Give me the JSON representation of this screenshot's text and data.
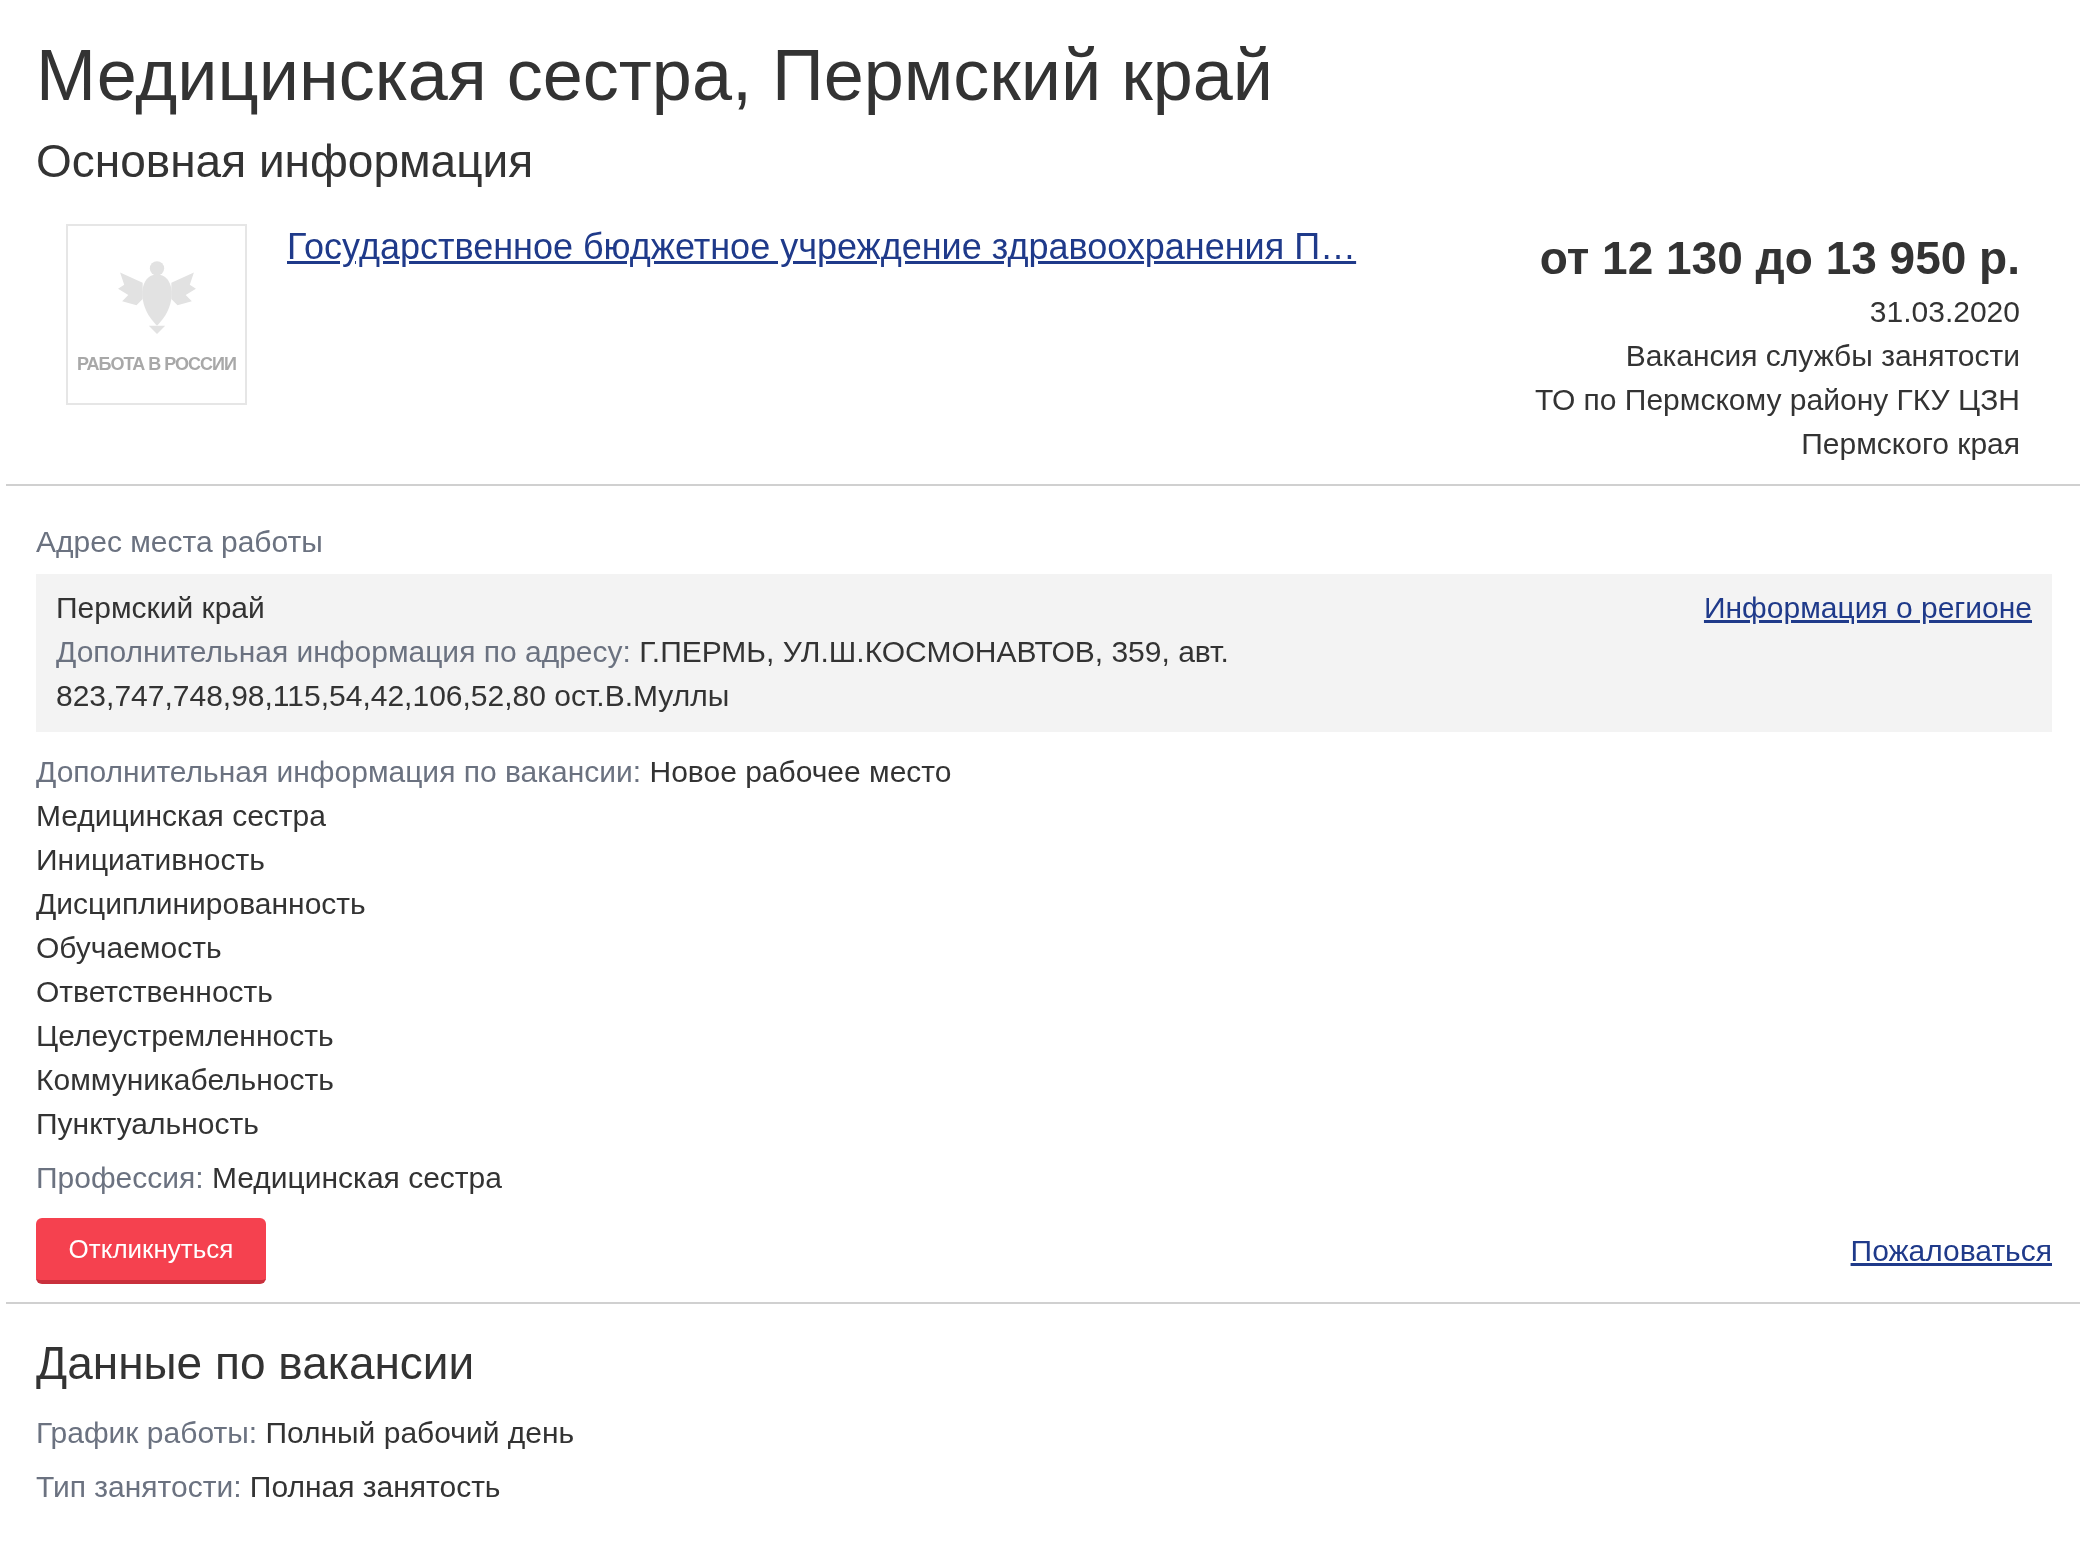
{
  "title": "Медицинская сестра, Пермский край",
  "section_title": "Основная информация",
  "employer": {
    "logo_text": "РАБОТА В РОССИИ",
    "name": "Государственное бюджетное учреждение здравоохранения П…"
  },
  "salary": "от 12 130 до 13 950 р.",
  "date": "31.03.2020",
  "source_lines": [
    "Вакансия службы занятости",
    "ТО по Пермскому району ГКУ ЦЗН",
    "Пермского края"
  ],
  "address": {
    "label": "Адрес места работы",
    "region": "Пермский край",
    "region_link": "Информация о регионе",
    "extra_label": "Дополнительная информация по адресу:",
    "extra_value": "Г.ПЕРМЬ, УЛ.Ш.КОСМОНАВТОВ, 359, авт. 823,747,748,98,115,54,42,106,52,80 ост.В.Муллы"
  },
  "vacancy_info": {
    "label": "Дополнительная информация по вакансии:",
    "value": "Новое рабочее место"
  },
  "requirements": [
    "Медицинская сестра",
    "Инициативность",
    "Дисциплинированность",
    "Обучаемость",
    "Ответственность",
    "Целеустремленность",
    "Коммуникабельность",
    "Пунктуальность"
  ],
  "profession": {
    "label": "Профессия:",
    "value": "Медицинская сестра"
  },
  "respond_button": "Откликнуться",
  "complain_link": "Пожаловаться",
  "details": {
    "title": "Данные по вакансии",
    "rows": [
      {
        "label": "График работы:",
        "value": "Полный рабочий день"
      },
      {
        "label": "Тип занятости:",
        "value": "Полная занятость"
      }
    ]
  }
}
